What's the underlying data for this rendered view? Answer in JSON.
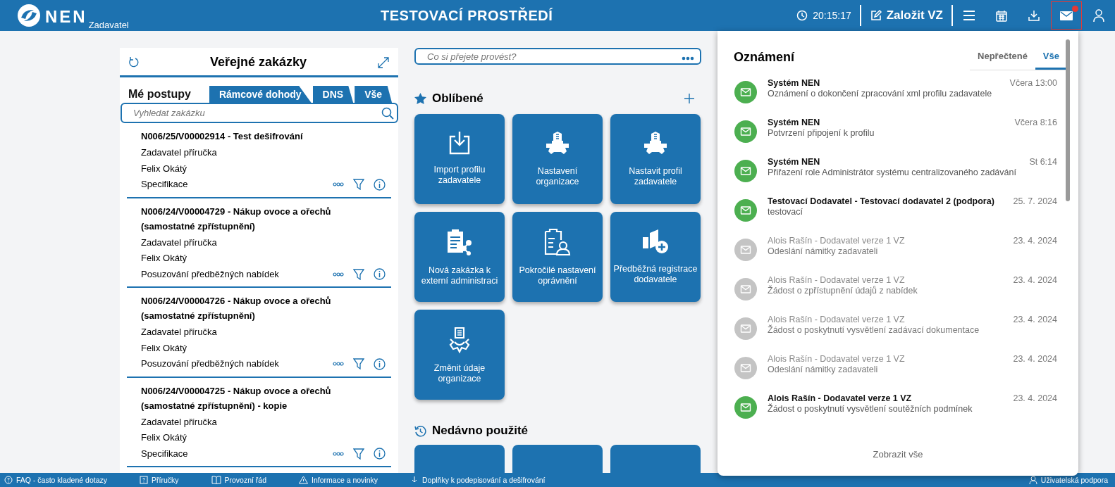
{
  "header": {
    "logo": "NEN",
    "role": "Zadavatel",
    "title": "TESTOVACÍ PROSTŘEDÍ",
    "time": "20:15:17",
    "create_button": "Založit VZ",
    "icons": [
      {
        "kind": "menu",
        "selected": false
      },
      {
        "kind": "calendar",
        "selected": false
      },
      {
        "kind": "download",
        "selected": false
      },
      {
        "kind": "mail",
        "selected": true
      },
      {
        "kind": "user",
        "selected": false
      }
    ]
  },
  "contracts": {
    "title": "Veřejné zakázky",
    "tabs": [
      {
        "label": "Mé postupy",
        "selected": true
      },
      {
        "label": "Rámcové dohody",
        "selected": false
      },
      {
        "label": "DNS",
        "selected": false
      },
      {
        "label": "Vše",
        "selected": false
      }
    ],
    "search": {
      "placeholder": "Vyhledat zakázku"
    },
    "items": [
      {
        "title": "N006/25/V00002914 - Test dešifrování",
        "lines": [
          "Zadavatel příručka",
          "Felix Okátý",
          "Specifikace"
        ]
      },
      {
        "title": "N006/24/V00004729 - Nákup ovoce a ořechů (samostatné zpřístupnění)",
        "lines": [
          "Zadavatel příručka",
          "Felix Okátý",
          "Posuzování předběžných nabídek"
        ]
      },
      {
        "title": "N006/24/V00004726 - Nákup ovoce a ořechů (samostatné zpřístupnění)",
        "lines": [
          "Zadavatel příručka",
          "Felix Okátý",
          "Posuzování předběžných nabídek"
        ]
      },
      {
        "title": "N006/24/V00004725 - Nákup ovoce a ořechů (samostatné zpřístupnění) - kopie",
        "lines": [
          "Zadavatel příručka",
          "Felix Okátý",
          "Specifikace"
        ]
      }
    ]
  },
  "command": {
    "placeholder": "Co si přejete provést?"
  },
  "favorites": {
    "title": "Oblíbené",
    "tiles": [
      {
        "kind": "import",
        "label": "Import profilu zadavatele"
      },
      {
        "kind": "org-gear",
        "label": "Nastavení organizace"
      },
      {
        "kind": "org-gear",
        "label": "Nastavit profil zadavatele"
      },
      {
        "kind": "clipboard-share",
        "label": "Nová zakázka k externí administraci"
      },
      {
        "kind": "clipboard-user",
        "label": "Pokročilé nastavení oprávnění"
      },
      {
        "kind": "building-plus",
        "label": "Předběžná registrace dodavatele"
      },
      {
        "kind": "hand-doc",
        "label": "Změnit údaje organizace"
      }
    ]
  },
  "recent": {
    "title": "Nedávno použité"
  },
  "notifications": {
    "title": "Oznámení",
    "tabs": [
      {
        "label": "Nepřečtené",
        "selected": false
      },
      {
        "label": "Vše",
        "selected": true
      }
    ],
    "items": [
      {
        "sender": "Systém NEN",
        "message": "Oznámení o dokončení zpracování xml profilu zadavatele",
        "time": "Včera 13:00",
        "unread": true
      },
      {
        "sender": "Systém NEN",
        "message": "Potvrzení připojení k profilu",
        "time": "Včera 8:16",
        "unread": true
      },
      {
        "sender": "Systém NEN",
        "message": "Přiřazení role Administrátor systému centralizovaného zadávání",
        "time": "St 6:14",
        "unread": true
      },
      {
        "sender": "Testovací Dodavatel - Testovací dodavatel 2 (podpora)",
        "message": "testovací",
        "time": "25. 7. 2024",
        "unread": true
      },
      {
        "sender": "Alois Rašín - Dodavatel verze 1 VZ",
        "message": "Odeslání námitky zadavateli",
        "time": "23. 4. 2024",
        "unread": false
      },
      {
        "sender": "Alois Rašín - Dodavatel verze 1 VZ",
        "message": "Žádost o zpřístupnění údajů z nabídek",
        "time": "23. 4. 2024",
        "unread": false
      },
      {
        "sender": "Alois Rašín - Dodavatel verze 1 VZ",
        "message": "Žádost o poskytnutí vysvětlení zadávací dokumentace",
        "time": "23. 4. 2024",
        "unread": false
      },
      {
        "sender": "Alois Rašín - Dodavatel verze 1 VZ",
        "message": "Odeslání námitky zadavateli",
        "time": "23. 4. 2024",
        "unread": false
      },
      {
        "sender": "Alois Rašín - Dodavatel verze 1 VZ",
        "message": "Žádost o poskytnutí vysvětlení soutěžních podmínek",
        "time": "23. 4. 2024",
        "unread": true
      }
    ],
    "show_all": "Zobrazit vše"
  },
  "footer": [
    {
      "kind": "help",
      "label": "FAQ - často kladené dotazy"
    },
    {
      "kind": "question",
      "label": "Příručky"
    },
    {
      "kind": "book",
      "label": "Provozní řád"
    },
    {
      "kind": "warning",
      "label": "Informace a novinky"
    },
    {
      "kind": "download",
      "label": "Doplňky k podepisování a dešifrování"
    },
    {
      "kind": "support",
      "label": "Uživatelská podpora"
    }
  ]
}
